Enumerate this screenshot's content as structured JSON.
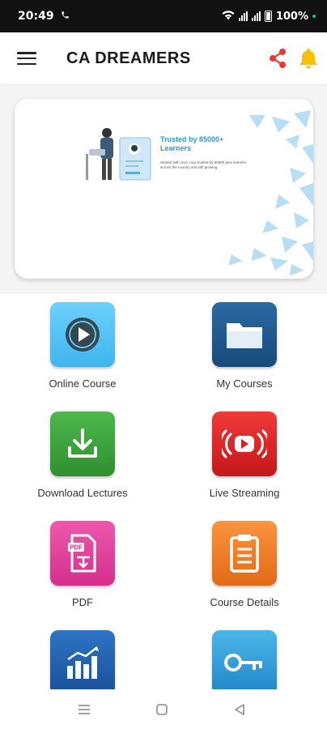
{
  "status_bar": {
    "time": "20:49",
    "battery": "100%",
    "call_icon": "phone-icon",
    "wifi_icon": "wifi-icon"
  },
  "app_bar": {
    "title": "CA DREAMERS",
    "menu_icon": "hamburger-menu-icon",
    "share_icon": "share-icon",
    "bell_icon": "bell-icon",
    "share_color": "#e53935",
    "bell_color": "#f6c000"
  },
  "banner": {
    "title": "Trusted by 85000+ Learners",
    "body": "Started with zero, now trusted by 85000 plus learners across the country and still growing.",
    "accent": "#2b9ad6"
  },
  "tiles": [
    {
      "label": "Online Course",
      "icon": "play-circle-icon",
      "color": "#4fc3f7"
    },
    {
      "label": "My Courses",
      "icon": "folder-icon",
      "color": "#1e5a8e"
    },
    {
      "label": "Download Lectures",
      "icon": "download-icon",
      "color": "#3aa13a"
    },
    {
      "label": "Live Streaming",
      "icon": "live-stream-icon",
      "color": "#e02424"
    },
    {
      "label": "PDF",
      "icon": "pdf-file-icon",
      "color": "#e23f9c"
    },
    {
      "label": "Course Details",
      "icon": "clipboard-icon",
      "color": "#f07d24"
    },
    {
      "label": "",
      "icon": "bar-chart-icon",
      "color": "#1e5fb0"
    },
    {
      "label": "",
      "icon": "key-icon",
      "color": "#2f9bd8"
    }
  ],
  "nav_bar": {
    "recent_icon": "recent-apps-icon",
    "home_icon": "home-icon",
    "back_icon": "back-icon"
  }
}
